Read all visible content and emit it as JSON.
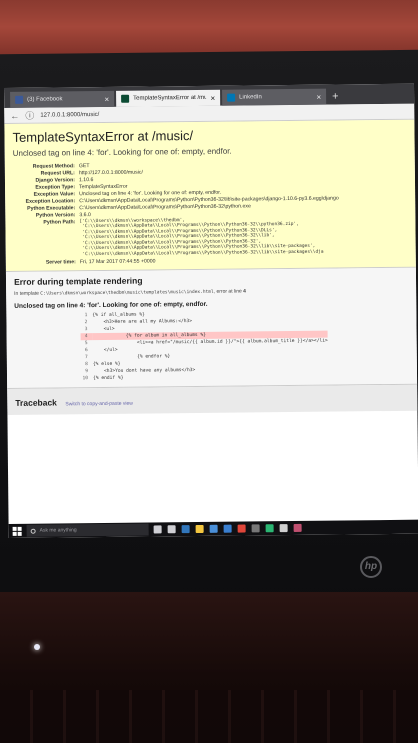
{
  "browser": {
    "tabs": [
      {
        "label": "(3) Facebook",
        "close": "×",
        "color": "#3b5998"
      },
      {
        "label": "TemplateSyntaxError at /music/",
        "close": "×",
        "color": "#0c4b33"
      },
      {
        "label": "LinkedIn",
        "close": "×",
        "color": "#0077b5"
      }
    ],
    "new_tab": "+",
    "back": "←",
    "info": "ⓘ",
    "url": "127.0.0.1:8000/music/"
  },
  "summary": {
    "title": "TemplateSyntaxError at /music/",
    "message": "Unclosed tag on line 4: 'for'. Looking for one of: empty, endfor.",
    "rows": [
      {
        "label": "Request Method:",
        "value": "GET"
      },
      {
        "label": "Request URL:",
        "value": "http://127.0.0.1:8000/music/"
      },
      {
        "label": "Django Version:",
        "value": "1.10.6"
      },
      {
        "label": "Exception Type:",
        "value": "TemplateSyntaxError"
      },
      {
        "label": "Exception Value:",
        "value": "Unclosed tag on line 4: 'for'. Looking for one of: empty, endfor."
      },
      {
        "label": "Exception Location:",
        "value": "C:\\Users\\dkmsn\\AppData\\Local\\Programs\\Python\\Python36-32\\lib\\site-packages\\django-1.10.6-py3.6.egg\\django"
      },
      {
        "label": "Python Executable:",
        "value": "C:\\Users\\dkmsn\\AppData\\Local\\Programs\\Python\\Python36-32\\python.exe"
      },
      {
        "label": "Python Version:",
        "value": "3.6.0"
      }
    ],
    "python_path_label": "Python Path:",
    "python_path": [
      "['C:\\\\Users\\\\dkmsn\\\\workspace\\\\thedbm',",
      " 'C:\\\\Users\\\\dkmsn\\\\AppData\\\\Local\\\\Programs\\\\Python\\\\Python36-32\\\\python36.zip',",
      " 'C:\\\\Users\\\\dkmsn\\\\AppData\\\\Local\\\\Programs\\\\Python\\\\Python36-32\\\\DLLs',",
      " 'C:\\\\Users\\\\dkmsn\\\\AppData\\\\Local\\\\Programs\\\\Python\\\\Python36-32\\\\lib',",
      " 'C:\\\\Users\\\\dkmsn\\\\AppData\\\\Local\\\\Programs\\\\Python\\\\Python36-32',",
      " 'C:\\\\Users\\\\dkmsn\\\\AppData\\\\Local\\\\Programs\\\\Python\\\\Python36-32\\\\lib\\\\site-packages',",
      " 'C:\\\\Users\\\\dkmsn\\\\AppData\\\\Local\\\\Programs\\\\Python\\\\Python36-32\\\\lib\\\\site-packages\\\\dja"
    ],
    "server_time_label": "Server time:",
    "server_time": "Fri, 17 Mar 2017 07:44:55 +0000"
  },
  "template": {
    "heading": "Error during template rendering",
    "in_template_prefix": "In template",
    "template_path": "C:\\Users\\dkmsn\\workspace\\thedbm\\music\\templates\\music\\index.html",
    "in_template_suffix": ", error at line",
    "error_line": "4",
    "message": "Unclosed tag on line 4: 'for'. Looking for one of: empty, endfor.",
    "lines": [
      {
        "n": "1",
        "code": "{% if all_albums %}",
        "err": false
      },
      {
        "n": "2",
        "code": "    <h3>Here are all my Albums:</h3>",
        "err": false
      },
      {
        "n": "3",
        "code": "    <ul>",
        "err": false
      },
      {
        "n": "4",
        "code": "            {% for album in all_albums %}",
        "err": true
      },
      {
        "n": "5",
        "code": "                <li><a href=\"/music/{{ album.id }}/\">{{ album.album_title }}</a></li>",
        "err": false
      },
      {
        "n": "6",
        "code": "    </ul>",
        "err": false
      },
      {
        "n": "7",
        "code": "                {% endfor %}",
        "err": false
      },
      {
        "n": "8",
        "code": "{% else %}",
        "err": false
      },
      {
        "n": "9",
        "code": "    <h3>You dont have any albums</h3>",
        "err": false
      },
      {
        "n": "10",
        "code": "{% endif %}",
        "err": false
      }
    ]
  },
  "traceback": {
    "heading": "Traceback",
    "switch_link": "Switch to copy-and-paste view"
  },
  "taskbar": {
    "search_placeholder": "Ask me anything",
    "icons": [
      {
        "name": "mic-icon",
        "color": "#cfcfd4"
      },
      {
        "name": "task-view-icon",
        "color": "#cfcfd4"
      },
      {
        "name": "edge-icon",
        "color": "#3277bc"
      },
      {
        "name": "file-explorer-icon",
        "color": "#f3c640"
      },
      {
        "name": "store-icon",
        "color": "#4a8fd8"
      },
      {
        "name": "mail-icon",
        "color": "#3a7fd0"
      },
      {
        "name": "chrome-icon",
        "color": "#e0463a"
      },
      {
        "name": "cmd-icon",
        "color": "#777"
      },
      {
        "name": "pycharm-icon",
        "color": "#2bb673"
      },
      {
        "name": "app-icon",
        "color": "#d0d0d0"
      },
      {
        "name": "app-icon-2",
        "color": "#c05070"
      }
    ]
  },
  "laptop": {
    "brand": "hp"
  }
}
